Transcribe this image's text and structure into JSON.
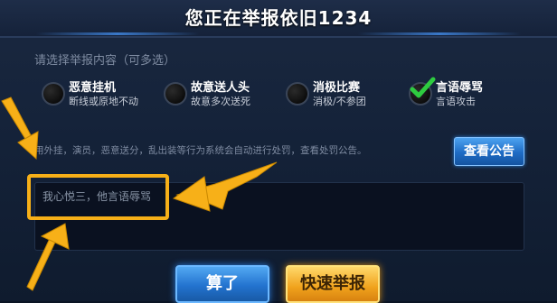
{
  "dialog": {
    "title": "您正在举报依旧1234",
    "subtitle": "请选择举报内容（可多选）"
  },
  "options": [
    {
      "label": "恶意挂机",
      "desc": "断线或原地不动",
      "checked": false
    },
    {
      "label": "故意送人头",
      "desc": "故意多次送死",
      "checked": false
    },
    {
      "label": "消极比赛",
      "desc": "消极/不参团",
      "checked": false
    },
    {
      "label": "言语辱骂",
      "desc": "言语攻击",
      "checked": true
    }
  ],
  "notice": "用外挂，演员，恶意送分，乱出装等行为系统会自动进行处罚，查看处罚公告。",
  "announce_button": "查看公告",
  "report_text": "我心悦三，他言语辱骂",
  "buttons": {
    "cancel": "算了",
    "report": "快速举报"
  },
  "colors": {
    "highlight": "#f7b018",
    "check": "#2ecc40",
    "blue_button": "#2373cf",
    "gold_button": "#f0a21c"
  },
  "icons": {
    "check": "check-icon",
    "radio": "radio-icon",
    "arrow": "arrow-icon"
  }
}
